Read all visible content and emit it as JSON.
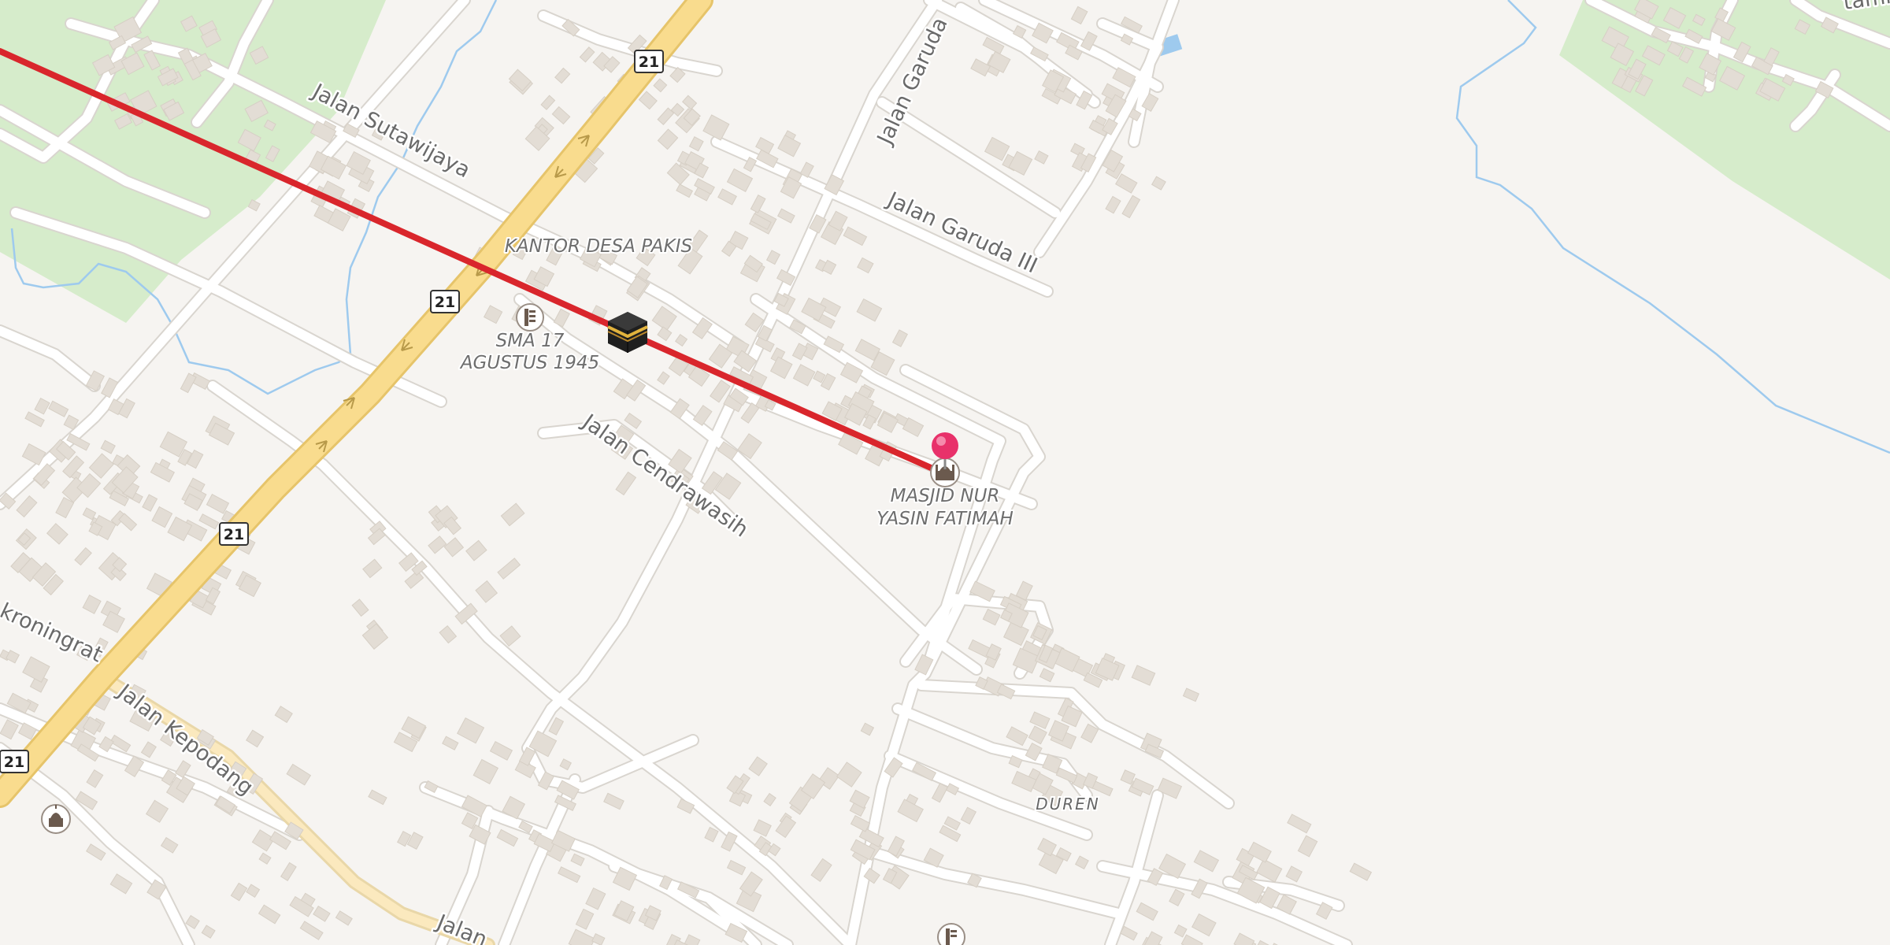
{
  "map": {
    "roads": {
      "sutawijaya": "Jalan Sutawijaya",
      "garuda": "Jalan Garuda",
      "garuda3": "Jalan Garuda III",
      "cendrawasih": "Jalan Cendrawasih",
      "kroningrat": "kroningrat",
      "kepodang": "Jalan Kepodang",
      "jalan_bottom": "Jalan",
      "tamn": "tamn"
    },
    "shield_number": "21",
    "pois": {
      "kantor": "KANTOR DESA PAKIS",
      "sma_line1": "SMA 17",
      "sma_line2": "AGUSTUS 1945",
      "masjid_line1": "MASJID NUR",
      "masjid_line2": "YASIN FATIMAH"
    },
    "places": {
      "duren": "DUREN"
    },
    "icons": [
      "kaaba-icon",
      "location-pin-icon",
      "mosque-icon",
      "school-icon"
    ],
    "colors": {
      "background": "#f6f4f1",
      "green_area": "#d6eccb",
      "building": "#e3ddd5",
      "primary_road": "#f9dc8e",
      "minor_road": "#ffffff",
      "water": "#9ecaee",
      "route_line": "#d9262c",
      "pin": "#e8316a"
    }
  }
}
